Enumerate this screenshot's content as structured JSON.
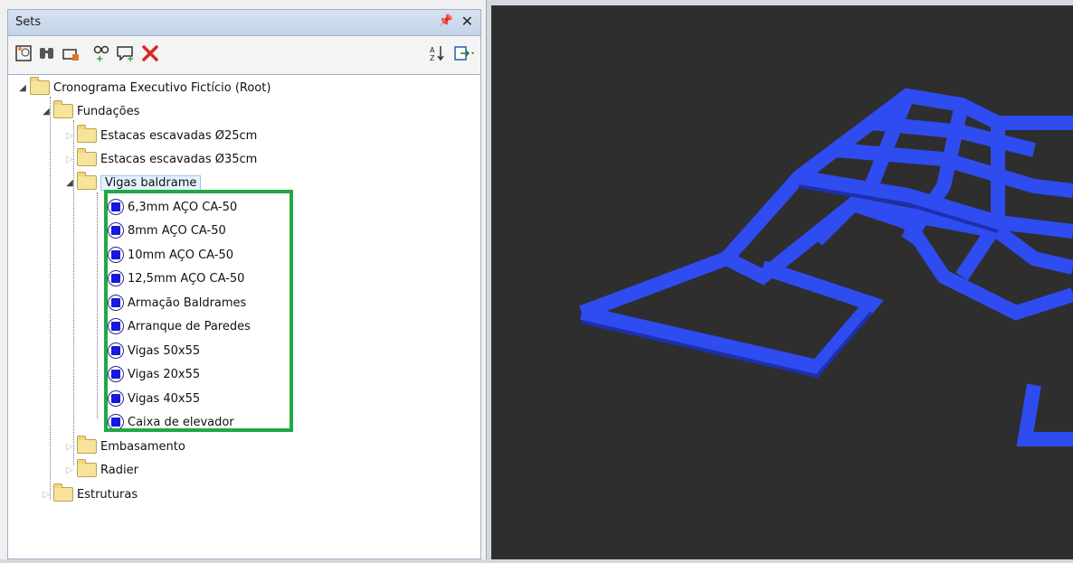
{
  "panel": {
    "title": "Sets"
  },
  "toolbar": {
    "icons": [
      "save-set-icon",
      "find-items-icon",
      "new-folder-icon",
      "add-search-set-icon",
      "add-comment-icon",
      "delete-icon",
      "sort-icon",
      "import-export-icon"
    ]
  },
  "tree": {
    "root": "Cronograma Executivo Fictício (Root)",
    "fundacoes": "Fundações",
    "estacas25": "Estacas escavadas Ø25cm",
    "estacas35": "Estacas escavadas Ø35cm",
    "vigas_baldrame": "Vigas baldrame",
    "sets": [
      "6,3mm AÇO CA-50",
      "8mm AÇO CA-50",
      "10mm AÇO CA-50",
      "12,5mm AÇO CA-50",
      "Armação Baldrames",
      "Arranque de Paredes",
      "Vigas 50x55",
      "Vigas 20x55",
      "Vigas 40x55",
      "Caixa de elevador"
    ],
    "embasamento": "Embasamento",
    "radier": "Radier",
    "estruturas": "Estruturas"
  },
  "colors": {
    "highlight": "#22a845",
    "beam": "#2f4cf0",
    "viewport_bg": "#2e2e2e"
  }
}
